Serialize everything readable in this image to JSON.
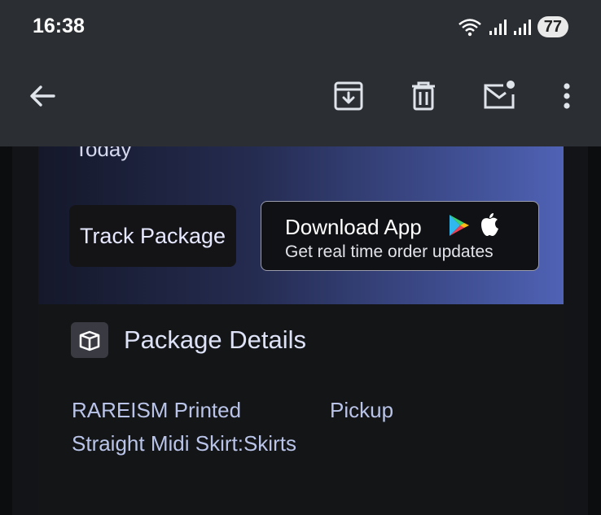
{
  "status_bar": {
    "time": "16:38",
    "battery": "77",
    "icons": [
      "wifi-icon",
      "signal-icon",
      "signal-icon"
    ]
  },
  "app_bar": {
    "icons": [
      "back-arrow-icon",
      "archive-icon",
      "delete-icon",
      "mark-unread-icon",
      "more-vert-icon"
    ]
  },
  "email": {
    "hero_partial_text": "Today",
    "track_button": "Track Package",
    "download_title": "Download App",
    "download_subtitle": "Get real time order updates",
    "section_title": "Package Details",
    "item_name": "RAREISM Printed Straight Midi Skirt:Skirts",
    "delivery_method": "Pickup"
  },
  "colors": {
    "app_bar_bg": "#2b2e33",
    "hero_gradient_start": "#15182a",
    "hero_gradient_end": "#4f62b5",
    "text_accent": "#b9c4e8"
  }
}
